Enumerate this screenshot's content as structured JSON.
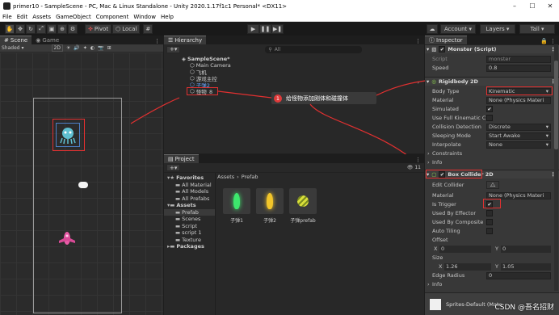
{
  "window": {
    "title": "primer10 - SampleScene - PC, Mac & Linux Standalone - Unity 2020.1.17f1c1 Personal* <DX11>",
    "controls": [
      "–",
      "☐",
      "✕"
    ]
  },
  "menu": [
    "File",
    "Edit",
    "Assets",
    "GameObject",
    "Component",
    "Window",
    "Help"
  ],
  "toolbar": {
    "pivot_label": "Pivot",
    "local_label": "Local",
    "play_icons": [
      "▶",
      "❚❚",
      "▶❚"
    ],
    "account_label": "Account",
    "layers_label": "Layers",
    "layout_label": "Tall"
  },
  "scene": {
    "tabs": [
      "Scene",
      "Game"
    ],
    "shading": "Shaded",
    "mode_2d": "2D"
  },
  "hierarchy": {
    "tab": "Hierarchy",
    "search_placeholder": "All",
    "items": [
      {
        "label": "SampleScene*",
        "level": 0
      },
      {
        "label": "Main Camera",
        "level": 1
      },
      {
        "label": "飞机",
        "level": 1
      },
      {
        "label": "游戏主控",
        "level": 1
      },
      {
        "label": "子弹2",
        "level": 1
      },
      {
        "label": "怪物_8",
        "level": 1
      }
    ]
  },
  "annotation": {
    "number": "1",
    "text": "给怪物添加刚体和碰撞体"
  },
  "project": {
    "tab": "Project",
    "count_badge": "11",
    "breadcrumb": [
      "Assets",
      "Prefab"
    ],
    "tree": [
      {
        "label": "Favorites",
        "level": 0,
        "bold": true
      },
      {
        "label": "All Material",
        "level": 1
      },
      {
        "label": "All Models",
        "level": 1
      },
      {
        "label": "All Prefabs",
        "level": 1
      },
      {
        "label": "Assets",
        "level": 0,
        "bold": true
      },
      {
        "label": "Prefab",
        "level": 1
      },
      {
        "label": "Scenes",
        "level": 1
      },
      {
        "label": "Script",
        "level": 1
      },
      {
        "label": "script 1",
        "level": 1
      },
      {
        "label": "Texture",
        "level": 1
      },
      {
        "label": "Packages",
        "level": 0,
        "bold": true
      }
    ],
    "assets": [
      {
        "label": "子弹1",
        "color": "#3de86d"
      },
      {
        "label": "子弹2",
        "color": "#f2c52a"
      },
      {
        "label": "子弹prefab",
        "color": "#d9df3a"
      }
    ]
  },
  "inspector": {
    "tab": "Inspector",
    "monster_script": {
      "title": "Monster (Script)",
      "script_label": "Script",
      "script_value": "monster",
      "speed_label": "Speed",
      "speed_value": "0.8"
    },
    "rigidbody": {
      "title": "Rigidbody 2D",
      "body_type_label": "Body Type",
      "body_type_value": "Kinematic",
      "material_label": "Material",
      "material_value": "None (Physics Materi",
      "simulated_label": "Simulated",
      "full_kinematic_label": "Use Full Kinematic C",
      "collision_label": "Collision Detection",
      "collision_value": "Discrete",
      "sleeping_label": "Sleeping Mode",
      "sleeping_value": "Start Awake",
      "interpolate_label": "Interpolate",
      "interpolate_value": "None",
      "constraints_label": "Constraints",
      "info_label": "Info"
    },
    "box_collider": {
      "title": "Box Collider 2D",
      "edit_collider_label": "Edit Collider",
      "material_label": "Material",
      "material_value": "None (Physics Materi",
      "is_trigger_label": "Is Trigger",
      "used_by_effector_label": "Used By Effector",
      "used_by_composite_label": "Used By Composite",
      "auto_tiling_label": "Auto Tiling",
      "offset_label": "Offset",
      "offset_x_label": "X",
      "offset_x": "0",
      "offset_y_label": "Y",
      "offset_y": "0",
      "size_label": "Size",
      "size_x_label": "X",
      "size_x": "1.26",
      "size_y_label": "Y",
      "size_y": "1.05",
      "edge_radius_label": "Edge Radius",
      "edge_radius": "0",
      "info_label": "Info"
    },
    "footer_label": "Sprites-Default (Mate"
  },
  "watermark": "CSDN @吾名招财"
}
